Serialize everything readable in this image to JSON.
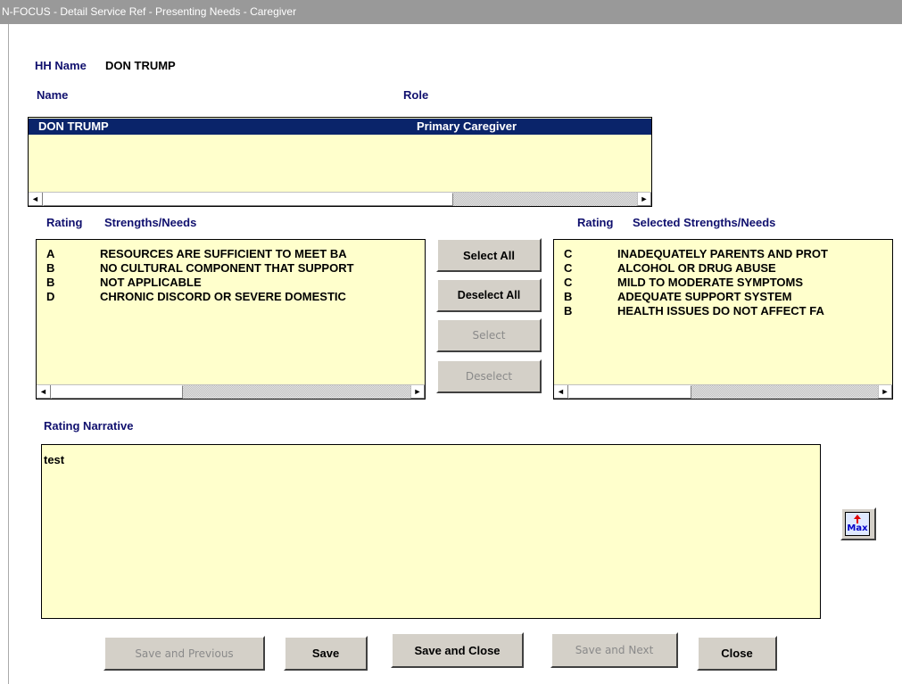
{
  "window": {
    "title": "N-FOCUS - Detail Service Ref - Presenting Needs - Caregiver"
  },
  "hh": {
    "label": "HH Name",
    "value": "DON TRUMP"
  },
  "members": {
    "name_header": "Name",
    "role_header": "Role",
    "rows": [
      {
        "name": "DON TRUMP",
        "role": "Primary Caregiver",
        "selected": true
      }
    ]
  },
  "available": {
    "rating_header": "Rating",
    "needs_header": "Strengths/Needs",
    "rows": [
      {
        "rating": "A",
        "need": "RESOURCES ARE SUFFICIENT TO MEET BA"
      },
      {
        "rating": "B",
        "need": "NO CULTURAL COMPONENT THAT SUPPORT"
      },
      {
        "rating": "B",
        "need": "NOT APPLICABLE"
      },
      {
        "rating": "D",
        "need": "CHRONIC DISCORD OR SEVERE DOMESTIC"
      }
    ]
  },
  "selected": {
    "rating_header": "Rating",
    "needs_header": "Selected Strengths/Needs",
    "rows": [
      {
        "rating": "C",
        "need": "INADEQUATELY PARENTS AND PROT"
      },
      {
        "rating": "C",
        "need": "ALCOHOL OR DRUG ABUSE"
      },
      {
        "rating": "C",
        "need": "MILD TO MODERATE SYMPTOMS"
      },
      {
        "rating": "B",
        "need": "ADEQUATE SUPPORT SYSTEM"
      },
      {
        "rating": "B",
        "need": "HEALTH ISSUES DO NOT AFFECT FA"
      }
    ]
  },
  "transfer": {
    "select_all": "Select All",
    "deselect_all": "Deselect All",
    "select": "Select",
    "deselect": "Deselect"
  },
  "narrative": {
    "label": "Rating Narrative",
    "value": "test",
    "max_label": "Max"
  },
  "footer": {
    "save_previous": "Save and Previous",
    "save": "Save",
    "save_close": "Save and Close",
    "save_next": "Save and Next",
    "close": "Close"
  },
  "colors": {
    "list_bg": "#ffffcc",
    "label": "#10106e",
    "selection": "#0a246a",
    "button_face": "#d4d0c8"
  }
}
